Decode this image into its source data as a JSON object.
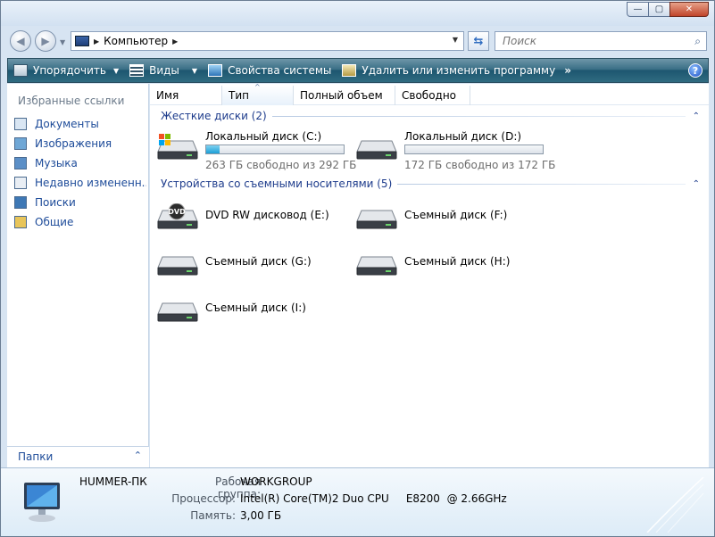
{
  "window": {
    "buttons": {
      "minimize": "—",
      "maximize": "▢",
      "close": "✕"
    }
  },
  "nav": {
    "back_glyph": "◀",
    "forward_glyph": "▶",
    "dropdown_glyph": "▼",
    "address_arrow": "▶",
    "address_text": "Компьютер",
    "address_trailing_arrow": "▶",
    "refresh_glyph": "⇆",
    "search_placeholder": "Поиск",
    "search_glyph": "⌕"
  },
  "toolbar": {
    "organize": "Упорядочить",
    "views": "Виды",
    "system_properties": "Свойства системы",
    "uninstall": "Удалить или изменить программу",
    "more": "»",
    "dropdown_glyph": "▼",
    "help": "?"
  },
  "sidebar": {
    "title": "Избранные ссылки",
    "items": [
      {
        "label": "Документы",
        "icon": "documents-icon",
        "color": "#d9e6f3"
      },
      {
        "label": "Изображения",
        "icon": "pictures-icon",
        "color": "#6fa7d6"
      },
      {
        "label": "Музыка",
        "icon": "music-icon",
        "color": "#5b8fc7"
      },
      {
        "label": "Недавно измененн...",
        "icon": "recent-icon",
        "color": "#e9eef4"
      },
      {
        "label": "Поиски",
        "icon": "searches-icon",
        "color": "#3e78b5"
      },
      {
        "label": "Общие",
        "icon": "public-folder-icon",
        "color": "#e8c55a"
      }
    ],
    "folders_label": "Папки",
    "folders_caret": "⌃"
  },
  "columns": [
    {
      "label": "Имя"
    },
    {
      "label": "Тип"
    },
    {
      "label": "Полный объем"
    },
    {
      "label": "Свободно"
    }
  ],
  "sort_glyph": "^",
  "groups": {
    "hard_disks": {
      "title": "Жесткие диски (2)",
      "caret": "⌃"
    },
    "removable": {
      "title": "Устройства со съемными носителями (5)",
      "caret": "⌃"
    }
  },
  "hard_disks": [
    {
      "name": "Локальный диск (C:)",
      "free": "263 ГБ свободно из 292 ГБ",
      "used_fraction": 0.1,
      "windows_logo": true
    },
    {
      "name": "Локальный диск (D:)",
      "free": "172 ГБ свободно из 172 ГБ",
      "used_fraction": 0.0,
      "windows_logo": false
    }
  ],
  "removable": [
    {
      "name": "DVD RW дисковод (E:)",
      "dvd": true,
      "dvd_label": "DVD"
    },
    {
      "name": "Съемный диск (F:)",
      "dvd": false
    },
    {
      "name": "Съемный диск (G:)",
      "dvd": false
    },
    {
      "name": "Съемный диск (H:)",
      "dvd": false
    },
    {
      "name": "Съемный диск (I:)",
      "dvd": false
    }
  ],
  "details": {
    "computer_name": "HUMMER-ПК",
    "workgroup_label": "Рабочая группа:",
    "workgroup": "WORKGROUP",
    "processor_label": "Процессор:",
    "processor": "Intel(R) Core(TM)2 Duo CPU     E8200  @ 2.66GHz",
    "memory_label": "Память:",
    "memory": "3,00 ГБ"
  }
}
